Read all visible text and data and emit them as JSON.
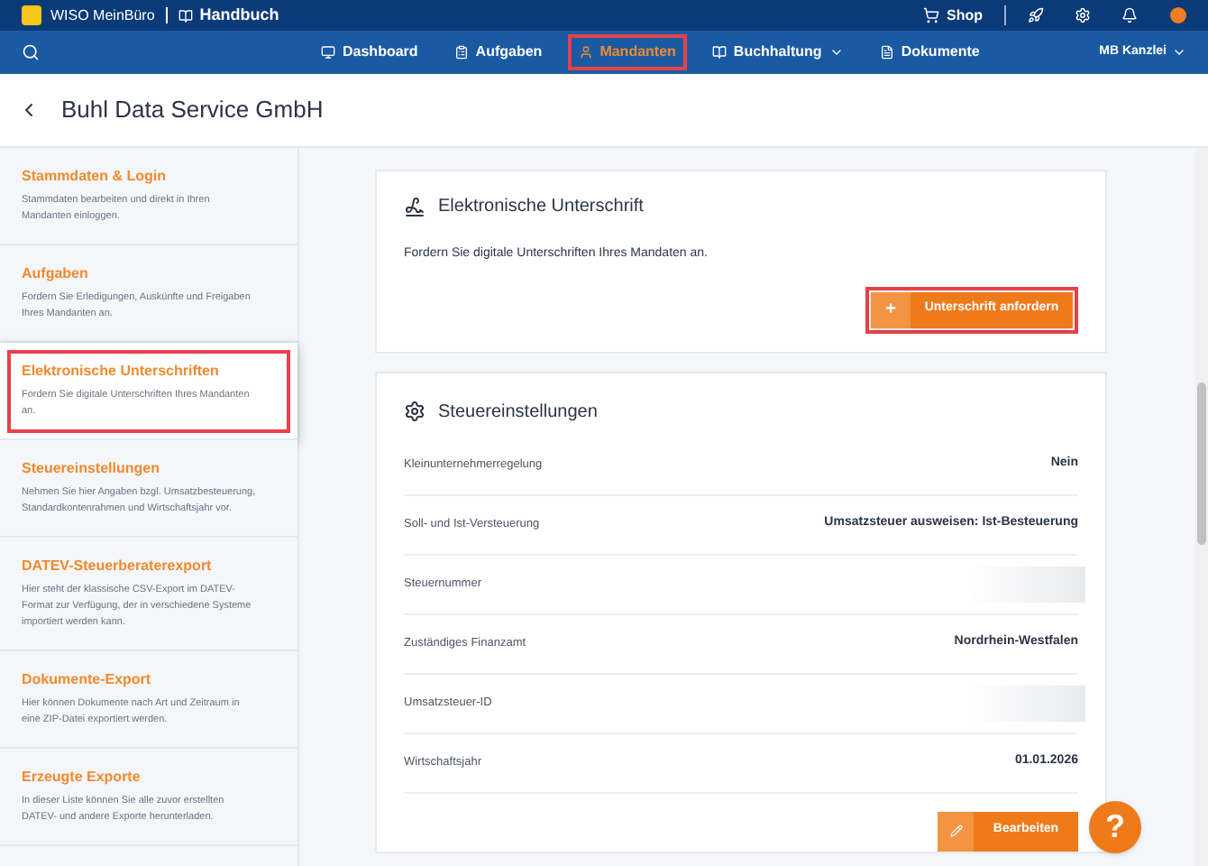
{
  "topbar": {
    "brand": "WISO MeinBüro",
    "manual": "Handbuch",
    "shop": "Shop"
  },
  "nav": {
    "items": [
      {
        "label": "Dashboard",
        "selected": false,
        "highlighted": false,
        "dropdown": false
      },
      {
        "label": "Aufgaben",
        "selected": false,
        "highlighted": false,
        "dropdown": false
      },
      {
        "label": "Mandanten",
        "selected": true,
        "highlighted": true,
        "dropdown": false
      },
      {
        "label": "Buchhaltung",
        "selected": false,
        "highlighted": false,
        "dropdown": true
      },
      {
        "label": "Dokumente",
        "selected": false,
        "highlighted": false,
        "dropdown": false
      }
    ],
    "account": "MB Kanzlei"
  },
  "page_title": "Buhl Data Service GmbH",
  "sidebar": {
    "items": [
      {
        "title": "Stammdaten & Login",
        "description": "Stammdaten bearbeiten und direkt in Ihren Mandanten einloggen.",
        "selected": false,
        "highlighted": false
      },
      {
        "title": "Aufgaben",
        "description": "Fordern Sie Erledigungen, Auskünfte und Freigaben Ihres Mandanten an.",
        "selected": false,
        "highlighted": false
      },
      {
        "title": "Elektronische Unterschriften",
        "description": "Fordern Sie digitale Unterschriften Ihres Mandanten an.",
        "selected": true,
        "highlighted": true
      },
      {
        "title": "Steuereinstellungen",
        "description": "Nehmen Sie hier Angaben bzgl. Umsatzbesteuerung, Standardkontenrahmen und Wirtschaftsjahr vor.",
        "selected": false,
        "highlighted": false
      },
      {
        "title": "DATEV-Steuerberaterexport",
        "description": "Hier steht der klassische CSV-Export im DATEV-Format zur Verfügung, der in verschiedene Systeme importiert werden kann.",
        "selected": false,
        "highlighted": false
      },
      {
        "title": "Dokumente-Export",
        "description": "Hier können Dokumente nach Art und Zeitraum in eine ZIP-Datei exportiert werden.",
        "selected": false,
        "highlighted": false
      },
      {
        "title": "Erzeugte Exporte",
        "description": "In dieser Liste können Sie alle zuvor erstellten DATEV- und andere Exporte herunterladen.",
        "selected": false,
        "highlighted": false
      }
    ]
  },
  "signature_card": {
    "title": "Elektronische Unterschrift",
    "text": "Fordern Sie digitale Unterschriften Ihres Mandaten an.",
    "button": {
      "icon": "+",
      "label": "Unterschrift anfordern",
      "highlighted": true
    }
  },
  "tax_card": {
    "title": "Steuereinstellungen",
    "rows": [
      {
        "kind": "text",
        "label": "Kleinunternehmerregelung",
        "value": "Nein"
      },
      {
        "kind": "text",
        "label": "Soll- und Ist-Versteuerung",
        "value": "Umsatzsteuer ausweisen: Ist-Besteuerung"
      },
      {
        "kind": "redacted",
        "label": "Steuernummer"
      },
      {
        "kind": "text",
        "label": "Zuständiges Finanzamt",
        "value": "Nordrhein-Westfalen"
      },
      {
        "kind": "redacted",
        "label": "Umsatzsteuer-ID"
      },
      {
        "kind": "text",
        "label": "Wirtschaftsjahr",
        "value": "01.01.2026"
      }
    ],
    "button": {
      "label": "Bearbeiten"
    }
  },
  "help_button": "?"
}
